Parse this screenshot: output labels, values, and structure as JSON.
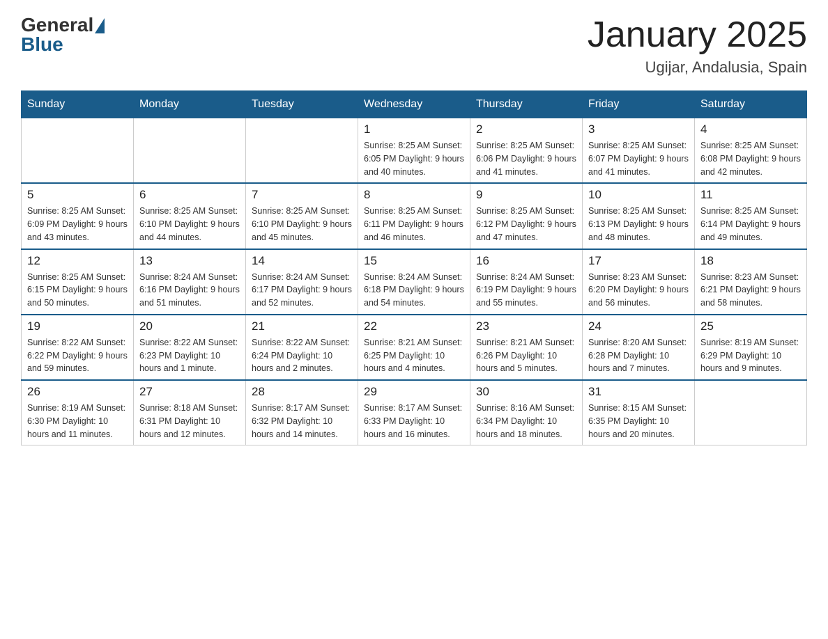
{
  "header": {
    "logo": {
      "general": "General",
      "blue": "Blue"
    },
    "title": "January 2025",
    "subtitle": "Ugijar, Andalusia, Spain"
  },
  "weekdays": [
    "Sunday",
    "Monday",
    "Tuesday",
    "Wednesday",
    "Thursday",
    "Friday",
    "Saturday"
  ],
  "weeks": [
    [
      {
        "day": "",
        "info": ""
      },
      {
        "day": "",
        "info": ""
      },
      {
        "day": "",
        "info": ""
      },
      {
        "day": "1",
        "info": "Sunrise: 8:25 AM\nSunset: 6:05 PM\nDaylight: 9 hours and 40 minutes."
      },
      {
        "day": "2",
        "info": "Sunrise: 8:25 AM\nSunset: 6:06 PM\nDaylight: 9 hours and 41 minutes."
      },
      {
        "day": "3",
        "info": "Sunrise: 8:25 AM\nSunset: 6:07 PM\nDaylight: 9 hours and 41 minutes."
      },
      {
        "day": "4",
        "info": "Sunrise: 8:25 AM\nSunset: 6:08 PM\nDaylight: 9 hours and 42 minutes."
      }
    ],
    [
      {
        "day": "5",
        "info": "Sunrise: 8:25 AM\nSunset: 6:09 PM\nDaylight: 9 hours and 43 minutes."
      },
      {
        "day": "6",
        "info": "Sunrise: 8:25 AM\nSunset: 6:10 PM\nDaylight: 9 hours and 44 minutes."
      },
      {
        "day": "7",
        "info": "Sunrise: 8:25 AM\nSunset: 6:10 PM\nDaylight: 9 hours and 45 minutes."
      },
      {
        "day": "8",
        "info": "Sunrise: 8:25 AM\nSunset: 6:11 PM\nDaylight: 9 hours and 46 minutes."
      },
      {
        "day": "9",
        "info": "Sunrise: 8:25 AM\nSunset: 6:12 PM\nDaylight: 9 hours and 47 minutes."
      },
      {
        "day": "10",
        "info": "Sunrise: 8:25 AM\nSunset: 6:13 PM\nDaylight: 9 hours and 48 minutes."
      },
      {
        "day": "11",
        "info": "Sunrise: 8:25 AM\nSunset: 6:14 PM\nDaylight: 9 hours and 49 minutes."
      }
    ],
    [
      {
        "day": "12",
        "info": "Sunrise: 8:25 AM\nSunset: 6:15 PM\nDaylight: 9 hours and 50 minutes."
      },
      {
        "day": "13",
        "info": "Sunrise: 8:24 AM\nSunset: 6:16 PM\nDaylight: 9 hours and 51 minutes."
      },
      {
        "day": "14",
        "info": "Sunrise: 8:24 AM\nSunset: 6:17 PM\nDaylight: 9 hours and 52 minutes."
      },
      {
        "day": "15",
        "info": "Sunrise: 8:24 AM\nSunset: 6:18 PM\nDaylight: 9 hours and 54 minutes."
      },
      {
        "day": "16",
        "info": "Sunrise: 8:24 AM\nSunset: 6:19 PM\nDaylight: 9 hours and 55 minutes."
      },
      {
        "day": "17",
        "info": "Sunrise: 8:23 AM\nSunset: 6:20 PM\nDaylight: 9 hours and 56 minutes."
      },
      {
        "day": "18",
        "info": "Sunrise: 8:23 AM\nSunset: 6:21 PM\nDaylight: 9 hours and 58 minutes."
      }
    ],
    [
      {
        "day": "19",
        "info": "Sunrise: 8:22 AM\nSunset: 6:22 PM\nDaylight: 9 hours and 59 minutes."
      },
      {
        "day": "20",
        "info": "Sunrise: 8:22 AM\nSunset: 6:23 PM\nDaylight: 10 hours and 1 minute."
      },
      {
        "day": "21",
        "info": "Sunrise: 8:22 AM\nSunset: 6:24 PM\nDaylight: 10 hours and 2 minutes."
      },
      {
        "day": "22",
        "info": "Sunrise: 8:21 AM\nSunset: 6:25 PM\nDaylight: 10 hours and 4 minutes."
      },
      {
        "day": "23",
        "info": "Sunrise: 8:21 AM\nSunset: 6:26 PM\nDaylight: 10 hours and 5 minutes."
      },
      {
        "day": "24",
        "info": "Sunrise: 8:20 AM\nSunset: 6:28 PM\nDaylight: 10 hours and 7 minutes."
      },
      {
        "day": "25",
        "info": "Sunrise: 8:19 AM\nSunset: 6:29 PM\nDaylight: 10 hours and 9 minutes."
      }
    ],
    [
      {
        "day": "26",
        "info": "Sunrise: 8:19 AM\nSunset: 6:30 PM\nDaylight: 10 hours and 11 minutes."
      },
      {
        "day": "27",
        "info": "Sunrise: 8:18 AM\nSunset: 6:31 PM\nDaylight: 10 hours and 12 minutes."
      },
      {
        "day": "28",
        "info": "Sunrise: 8:17 AM\nSunset: 6:32 PM\nDaylight: 10 hours and 14 minutes."
      },
      {
        "day": "29",
        "info": "Sunrise: 8:17 AM\nSunset: 6:33 PM\nDaylight: 10 hours and 16 minutes."
      },
      {
        "day": "30",
        "info": "Sunrise: 8:16 AM\nSunset: 6:34 PM\nDaylight: 10 hours and 18 minutes."
      },
      {
        "day": "31",
        "info": "Sunrise: 8:15 AM\nSunset: 6:35 PM\nDaylight: 10 hours and 20 minutes."
      },
      {
        "day": "",
        "info": ""
      }
    ]
  ]
}
